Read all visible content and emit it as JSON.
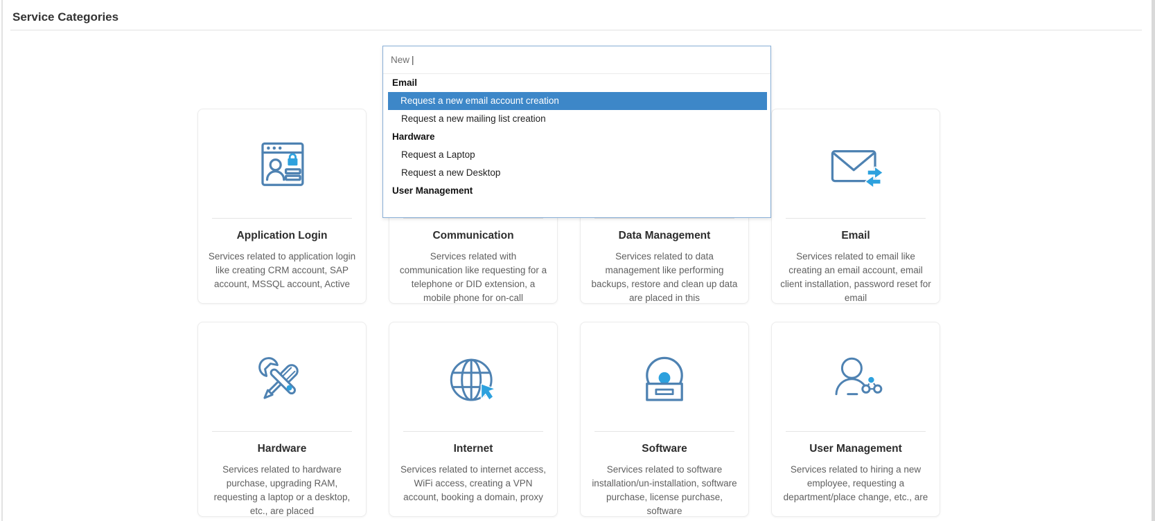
{
  "page": {
    "title": "Service Categories"
  },
  "colors": {
    "highlight_blue": "#3d87c8",
    "dropdown_border": "#88aed6",
    "icon_stroke": "#4e82b2",
    "icon_accent": "#2da1de"
  },
  "search_dropdown": {
    "input_value": "New",
    "cursor": "|",
    "groups": [
      {
        "label": "Email",
        "items": [
          {
            "label": "Request a new email account creation",
            "highlighted": true
          },
          {
            "label": "Request a new mailing list creation",
            "highlighted": false
          }
        ]
      },
      {
        "label": "Hardware",
        "items": [
          {
            "label": "Request a Laptop",
            "highlighted": false
          },
          {
            "label": "Request a new Desktop",
            "highlighted": false
          }
        ]
      },
      {
        "label": "User Management",
        "items": []
      }
    ]
  },
  "categories": [
    {
      "title": "Application Login",
      "description": "Services related to application login like creating CRM account, SAP account, MSSQL account, Active",
      "icon": "application-login-icon"
    },
    {
      "title": "Communication",
      "description": "Services related with communication like requesting for a telephone or DID extension, a mobile phone for on-call",
      "icon": "communication-icon"
    },
    {
      "title": "Data Management",
      "description": "Services related to data management like performing backups, restore and clean up data are placed in this",
      "icon": "data-management-icon"
    },
    {
      "title": "Email",
      "description": "Services related to email like creating an email account, email client installation, password reset for email",
      "icon": "email-icon"
    },
    {
      "title": "Hardware",
      "description": "Services related to hardware purchase, upgrading RAM, requesting a laptop or a desktop, etc., are placed",
      "icon": "hardware-icon"
    },
    {
      "title": "Internet",
      "description": "Services related to internet access, WiFi access, creating a VPN account, booking a domain, proxy",
      "icon": "internet-icon"
    },
    {
      "title": "Software",
      "description": "Services related to software installation/un-installation, software purchase, license purchase, software",
      "icon": "software-icon"
    },
    {
      "title": "User Management",
      "description": "Services related to hiring a new employee, requesting a department/place change, etc., are",
      "icon": "user-management-icon"
    }
  ]
}
